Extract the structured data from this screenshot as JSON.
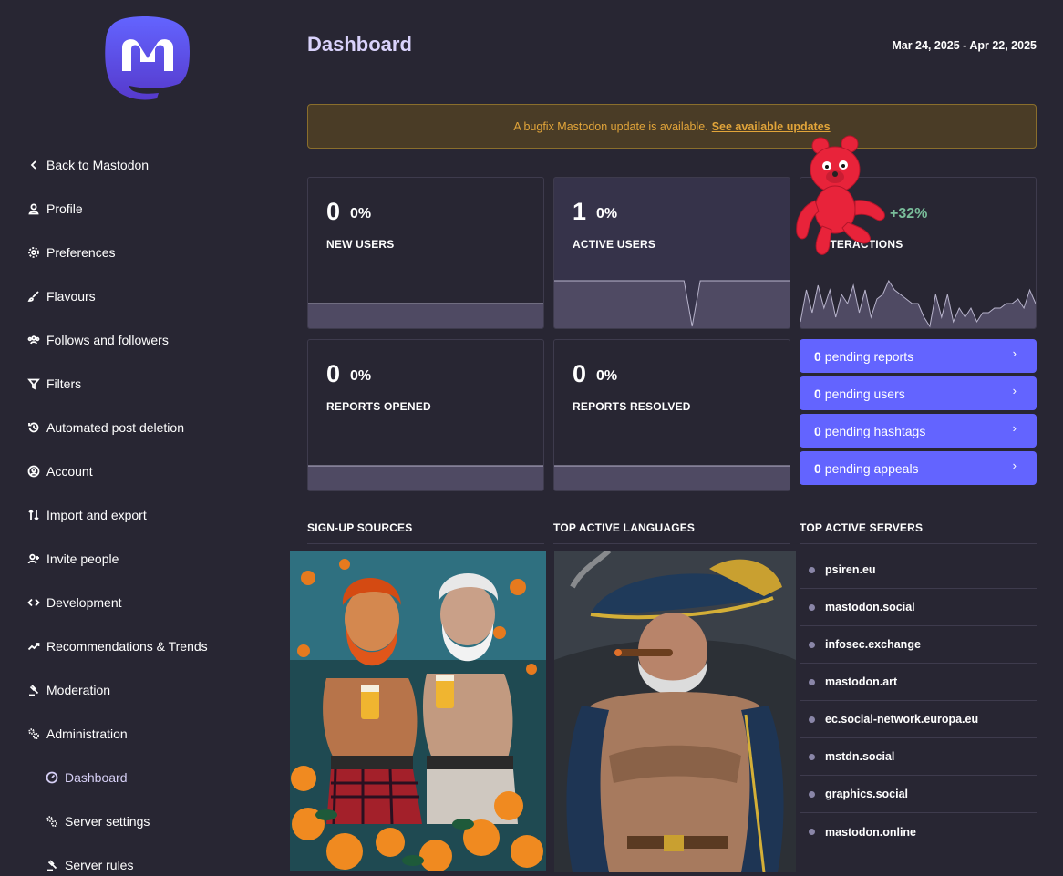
{
  "sidebar": {
    "logo_icon": "mastodon-logo",
    "items": [
      {
        "label": "Back to Mastodon",
        "icon": "chevron-left-icon"
      },
      {
        "label": "Profile",
        "icon": "person-icon"
      },
      {
        "label": "Preferences",
        "icon": "gear-icon"
      },
      {
        "label": "Flavours",
        "icon": "paintbrush-icon"
      },
      {
        "label": "Follows and followers",
        "icon": "people-icon"
      },
      {
        "label": "Filters",
        "icon": "filter-icon"
      },
      {
        "label": "Automated post deletion",
        "icon": "history-icon"
      },
      {
        "label": "Account",
        "icon": "account-circle-icon"
      },
      {
        "label": "Import and export",
        "icon": "import-export-icon"
      },
      {
        "label": "Invite people",
        "icon": "person-add-icon"
      },
      {
        "label": "Development",
        "icon": "code-icon"
      },
      {
        "label": "Recommendations & Trends",
        "icon": "trending-icon"
      },
      {
        "label": "Moderation",
        "icon": "gavel-icon"
      },
      {
        "label": "Administration",
        "icon": "gears-icon"
      },
      {
        "label": "Dashboard",
        "icon": "speedometer-icon"
      },
      {
        "label": "Server settings",
        "icon": "gears-icon"
      },
      {
        "label": "Server rules",
        "icon": "gavel-icon"
      }
    ]
  },
  "header": {
    "title": "Dashboard",
    "date_range": "Mar 24, 2025 - Apr 22, 2025"
  },
  "banner": {
    "text": "A bugfix Mastodon update is available.",
    "link": "See available updates",
    "color": "#e2a53a"
  },
  "metrics": [
    {
      "value": "0",
      "change": "0%",
      "label": "NEW USERS",
      "sparkline": [
        0,
        0,
        0,
        0,
        0,
        0,
        0,
        0,
        0,
        0,
        0,
        0,
        0,
        0,
        0,
        0,
        0,
        0,
        0,
        0,
        0,
        0,
        0,
        0,
        0,
        0,
        0,
        0,
        0,
        0
      ]
    },
    {
      "value": "1",
      "change": "0%",
      "label": "ACTIVE USERS",
      "sparkline": [
        1,
        1,
        1,
        1,
        1,
        1,
        1,
        1,
        1,
        1,
        1,
        1,
        1,
        1,
        1,
        1,
        1,
        0,
        1,
        1,
        1,
        1,
        1,
        1,
        1,
        1,
        1,
        1,
        1,
        1
      ]
    },
    {
      "value": "",
      "change": "+32%",
      "label": "INTERACTIONS",
      "sparkline": [
        2,
        9,
        4,
        10,
        5,
        9,
        3,
        8,
        6,
        10,
        4,
        9,
        3,
        7,
        8,
        11,
        9,
        8,
        7,
        6,
        6,
        3,
        1,
        8,
        3,
        8,
        2,
        5,
        3,
        5,
        2,
        4,
        4,
        5,
        5,
        6,
        6,
        7,
        5,
        9,
        6
      ]
    },
    {
      "value": "0",
      "change": "0%",
      "label": "REPORTS OPENED",
      "sparkline": [
        0,
        0,
        0,
        0,
        0,
        0,
        0,
        0,
        0,
        0,
        0,
        0,
        0,
        0,
        0,
        0,
        0,
        0,
        0,
        0,
        0,
        0,
        0,
        0,
        0,
        0,
        0,
        0,
        0,
        0
      ]
    },
    {
      "value": "0",
      "change": "0%",
      "label": "REPORTS RESOLVED",
      "sparkline": [
        0,
        0,
        0,
        0,
        0,
        0,
        0,
        0,
        0,
        0,
        0,
        0,
        0,
        0,
        0,
        0,
        0,
        0,
        0,
        0,
        0,
        0,
        0,
        0,
        0,
        0,
        0,
        0,
        0,
        0
      ]
    }
  ],
  "pending": [
    {
      "count": "0",
      "label": "pending reports"
    },
    {
      "count": "0",
      "label": "pending users"
    },
    {
      "count": "0",
      "label": "pending hashtags"
    },
    {
      "count": "0",
      "label": "pending appeals"
    }
  ],
  "sections": {
    "signup": "SIGN-UP SOURCES",
    "languages": "TOP ACTIVE LANGUAGES",
    "servers": "TOP ACTIVE SERVERS"
  },
  "servers": [
    "psiren.eu",
    "mastodon.social",
    "infosec.exchange",
    "mastodon.art",
    "ec.social-network.europa.eu",
    "mstdn.social",
    "graphics.social",
    "mastodon.online"
  ],
  "colors": {
    "accent": "#6364ff",
    "background": "#282633",
    "title": "#d9d2fb",
    "positive": "#79bd9a"
  }
}
